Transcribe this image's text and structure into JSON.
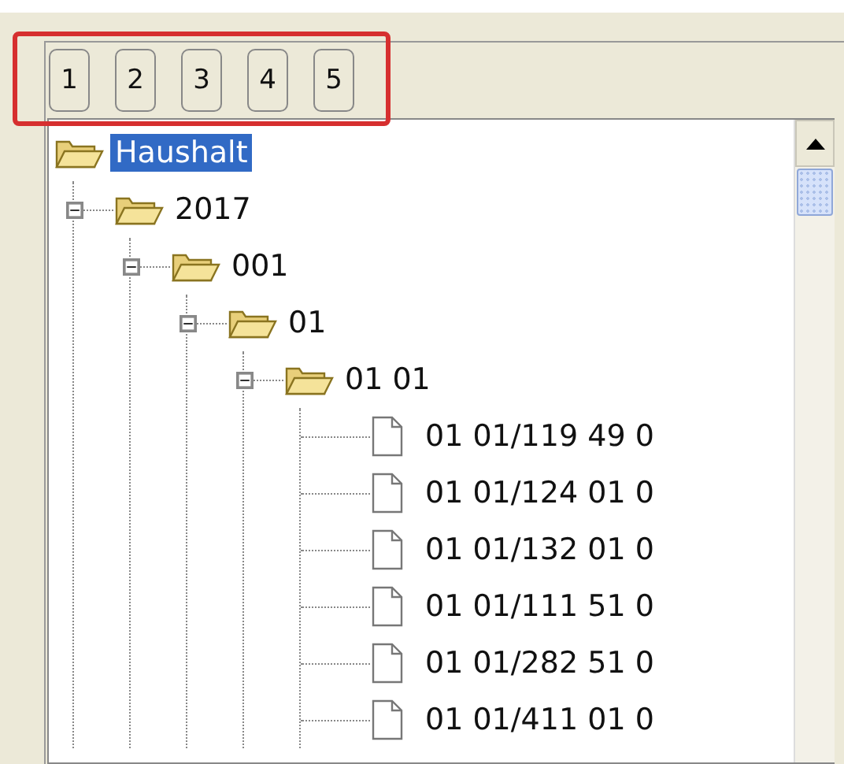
{
  "tab_buttons": [
    {
      "label": "1"
    },
    {
      "label": "2"
    },
    {
      "label": "3"
    },
    {
      "label": "4"
    },
    {
      "label": "5"
    }
  ],
  "tree": [
    {
      "label": "Haushalt",
      "kind": "folder",
      "selected": true,
      "expanded": true,
      "children": [
        {
          "label": "2017",
          "kind": "folder",
          "selected": false,
          "expanded": true,
          "children": [
            {
              "label": "001",
              "kind": "folder",
              "selected": false,
              "expanded": true,
              "children": [
                {
                  "label": "01",
                  "kind": "folder",
                  "selected": false,
                  "expanded": true,
                  "children": [
                    {
                      "label": "01 01",
                      "kind": "folder",
                      "selected": false,
                      "expanded": true,
                      "children": [
                        {
                          "label": "01 01/119 49 0",
                          "kind": "file",
                          "selected": false
                        },
                        {
                          "label": "01 01/124 01 0",
                          "kind": "file",
                          "selected": false
                        },
                        {
                          "label": "01 01/132 01 0",
                          "kind": "file",
                          "selected": false
                        },
                        {
                          "label": "01 01/111 51 0",
                          "kind": "file",
                          "selected": false
                        },
                        {
                          "label": "01 01/282 51 0",
                          "kind": "file",
                          "selected": false
                        },
                        {
                          "label": "01 01/411 01 0",
                          "kind": "file",
                          "selected": false
                        }
                      ]
                    }
                  ]
                }
              ]
            }
          ]
        }
      ]
    }
  ]
}
